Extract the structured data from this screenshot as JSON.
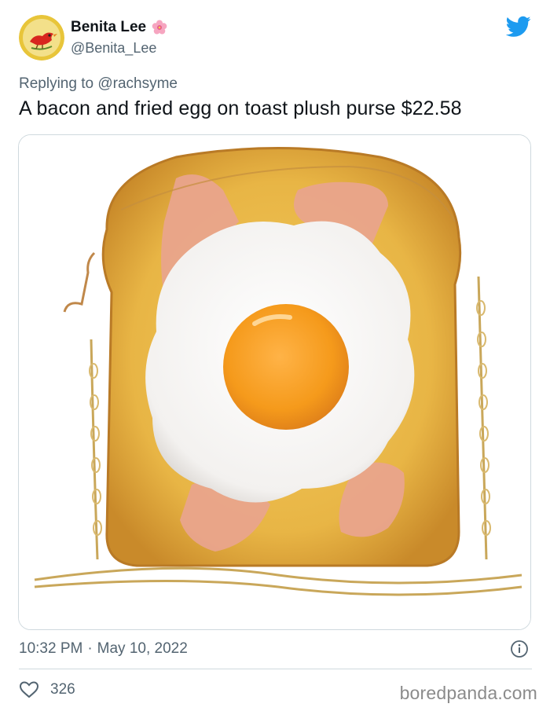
{
  "author": {
    "display_name": "Benita Lee",
    "name_emoji": "flower-emoji",
    "handle": "@Benita_Lee",
    "avatar": "red-bird-avatar"
  },
  "platform_icon": "twitter-bird-icon",
  "reply": {
    "prefix": "Replying to",
    "to_handle": "@rachsyme"
  },
  "tweet_text": "A bacon and fried egg on toast plush purse $22.58",
  "media": {
    "description_icon": "toast-purse-image"
  },
  "timestamp": {
    "time": "10:32 PM",
    "separator": "·",
    "date": "May 10, 2022"
  },
  "actions": {
    "like_count": "326"
  },
  "watermark": "boredpanda.com",
  "colors": {
    "twitter_blue": "#1d9bf0",
    "text_primary": "#0f1419",
    "text_secondary": "#536471",
    "border": "#cfd9de"
  }
}
